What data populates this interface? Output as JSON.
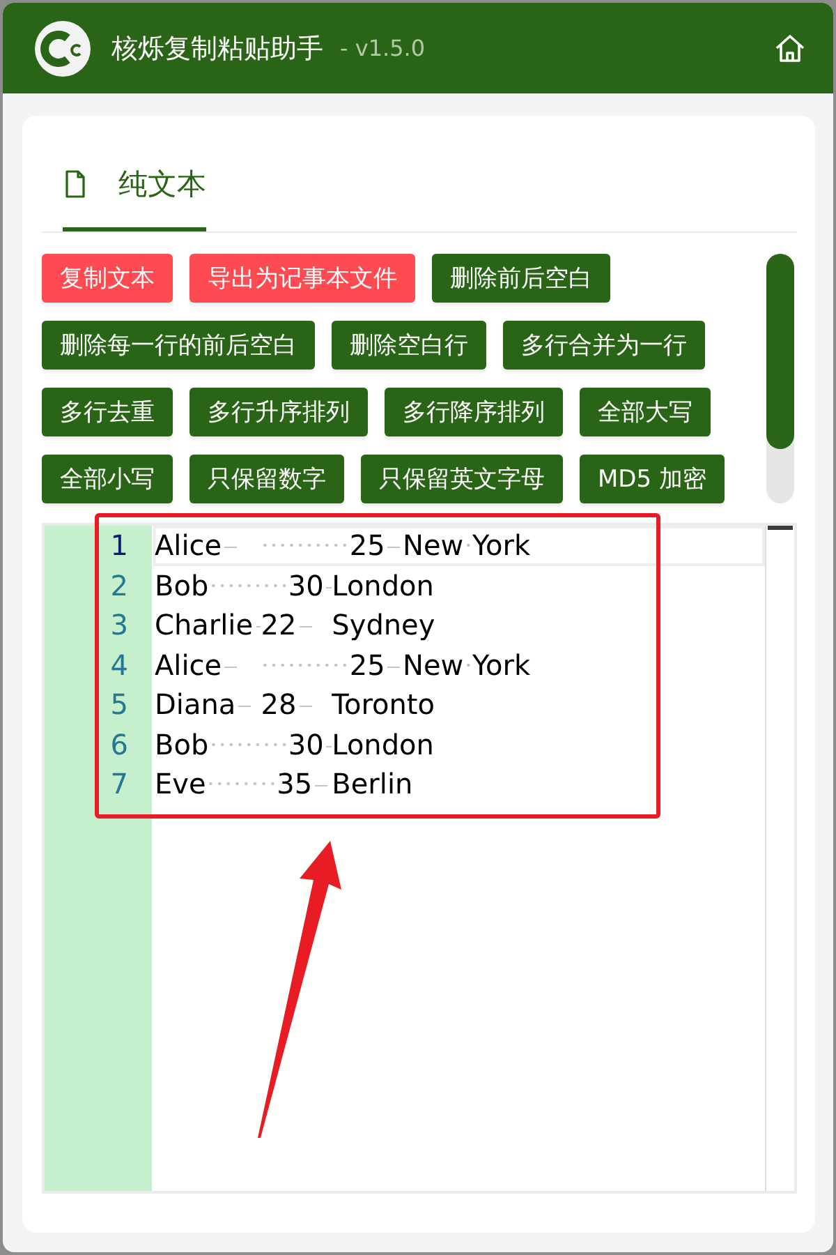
{
  "app": {
    "title": "核烁复制粘贴助手",
    "version": "- v1.5.0"
  },
  "tabs": [
    {
      "label": "纯文本",
      "selected": true
    }
  ],
  "buttons": [
    {
      "label": "复制文本",
      "kind": "danger"
    },
    {
      "label": "导出为记事本文件",
      "kind": "danger"
    },
    {
      "label": "删除前后空白",
      "kind": "primary"
    },
    {
      "label": "删除每一行的前后空白",
      "kind": "primary"
    },
    {
      "label": "删除空白行",
      "kind": "primary"
    },
    {
      "label": "多行合并为一行",
      "kind": "primary"
    },
    {
      "label": "多行去重",
      "kind": "primary"
    },
    {
      "label": "多行升序排列",
      "kind": "primary"
    },
    {
      "label": "多行降序排列",
      "kind": "primary"
    },
    {
      "label": "全部大写",
      "kind": "primary"
    },
    {
      "label": "全部小写",
      "kind": "primary"
    },
    {
      "label": "只保留数字",
      "kind": "primary"
    },
    {
      "label": "只保留英文字母",
      "kind": "primary"
    },
    {
      "label": "MD5 加密",
      "kind": "primary"
    }
  ],
  "editor": {
    "lines": [
      {
        "number": "1",
        "text": "Alice\t          25\tNew York",
        "current": true
      },
      {
        "number": "2",
        "text": "Bob         30\tLondon",
        "current": false
      },
      {
        "number": "3",
        "text": "Charlie\t22\tSydney",
        "current": false
      },
      {
        "number": "4",
        "text": "Alice\t          25\tNew York",
        "current": false
      },
      {
        "number": "5",
        "text": "Diana\t28\tToronto",
        "current": false
      },
      {
        "number": "6",
        "text": "Bob         30\tLondon",
        "current": false
      },
      {
        "number": "7",
        "text": "Eve        35\tBerlin",
        "current": false
      }
    ]
  }
}
